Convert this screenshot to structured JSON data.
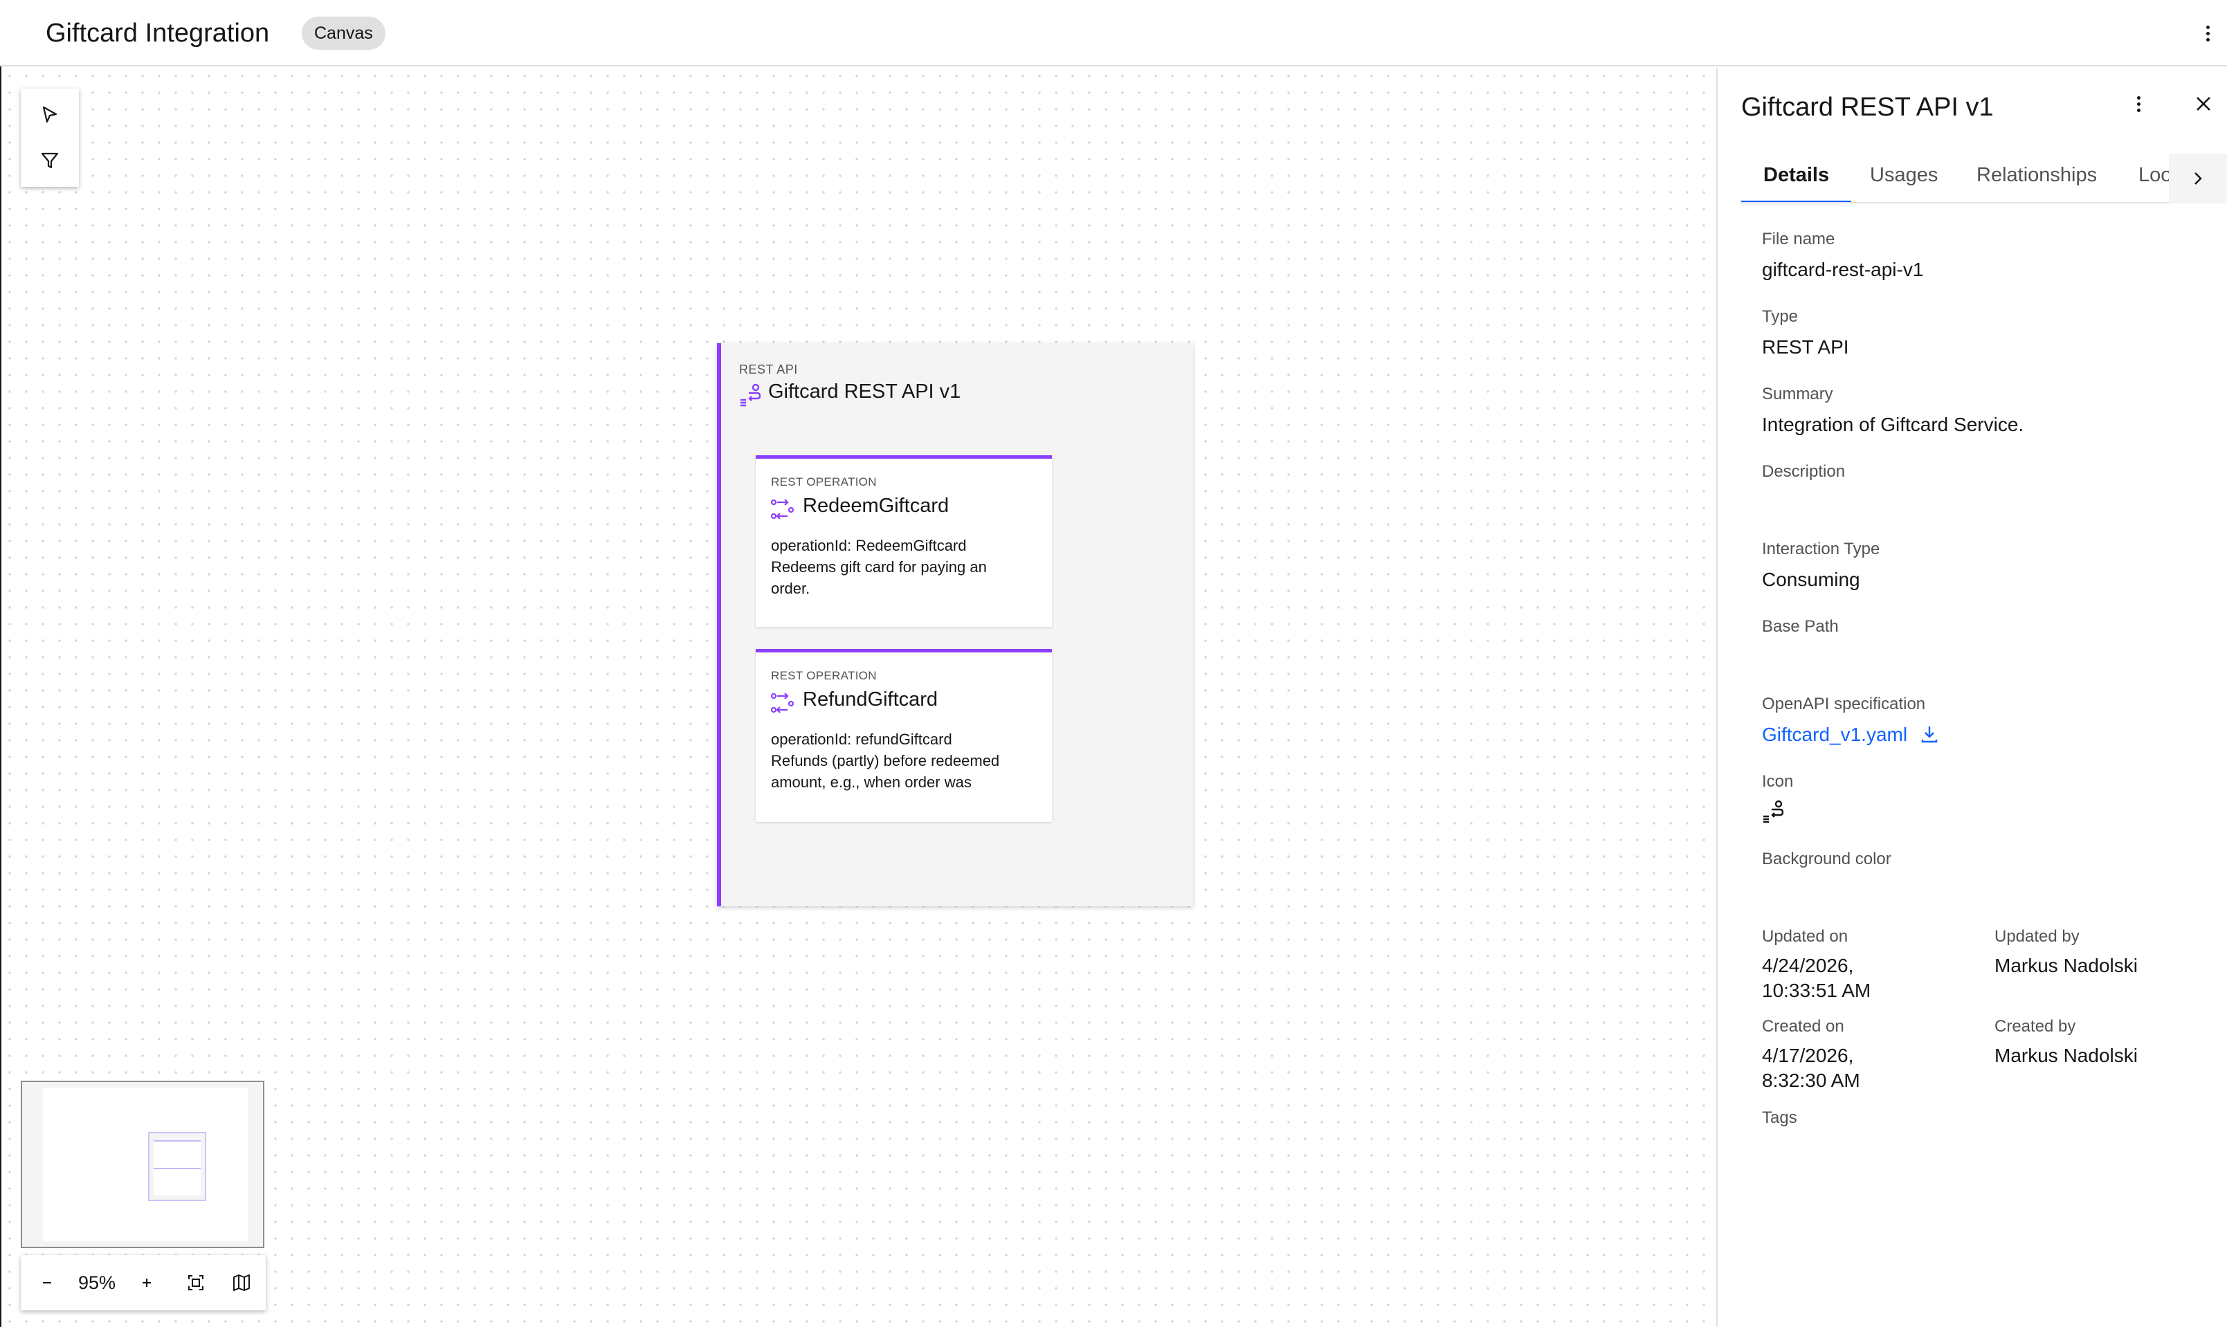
{
  "header": {
    "title": "Giftcard Integration",
    "tag": "Canvas"
  },
  "canvas": {
    "zoom": "95%",
    "api_node": {
      "type_label": "REST API",
      "title": "Giftcard REST API v1",
      "operations": [
        {
          "type_label": "REST OPERATION",
          "title": "RedeemGiftcard",
          "description": "operationId: RedeemGiftcard\nRedeems gift card for paying an\norder."
        },
        {
          "type_label": "REST OPERATION",
          "title": "RefundGiftcard",
          "description": "operationId: refundGiftcard\nRefunds (partly) before redeemed\namount, e.g., when order was"
        }
      ]
    }
  },
  "panel": {
    "title": "Giftcard REST API v1",
    "tabs": [
      "Details",
      "Usages",
      "Relationships",
      "Loo"
    ],
    "active_tab": "Details",
    "fields": {
      "file_name_label": "File name",
      "file_name": "giftcard-rest-api-v1",
      "type_label": "Type",
      "type": "REST API",
      "summary_label": "Summary",
      "summary": "Integration of Giftcard Service.",
      "description_label": "Description",
      "interaction_type_label": "Interaction Type",
      "interaction_type": "Consuming",
      "base_path_label": "Base Path",
      "openapi_label": "OpenAPI specification",
      "openapi_file": "Giftcard_v1.yaml",
      "icon_label": "Icon",
      "icon_name": "rest-api-icon",
      "background_color_label": "Background color",
      "updated_on_label": "Updated on",
      "updated_on_date": "4/24/2026,",
      "updated_on_time": "10:33:51 AM",
      "updated_by_label": "Updated by",
      "updated_by": "Markus Nadolski",
      "created_on_label": "Created on",
      "created_on_date": "4/17/2026,",
      "created_on_time": "8:32:30 AM",
      "created_by_label": "Created by",
      "created_by": "Markus Nadolski",
      "tags_label": "Tags"
    }
  },
  "colors": {
    "accent_purple": "#8a3ffc",
    "link_blue": "#0f62fe",
    "tab_indicator": "#0f62fe"
  }
}
